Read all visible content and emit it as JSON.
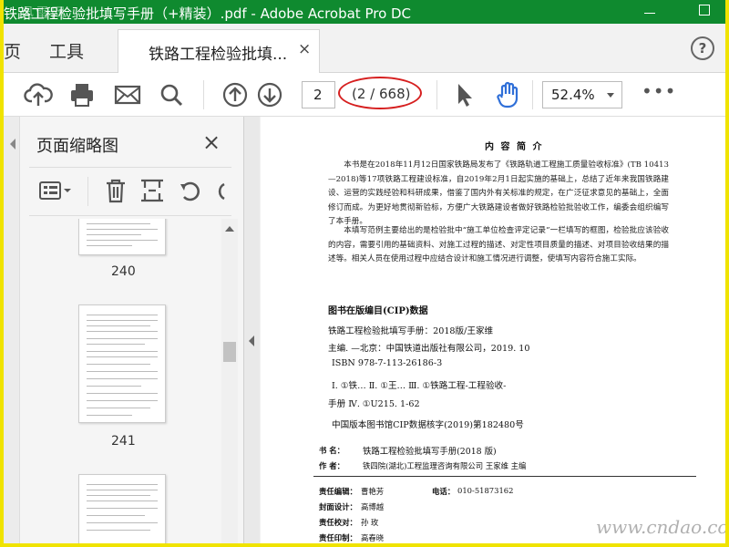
{
  "window": {
    "title": "铁路工程检验批填写手册（+精装）.pdf - Adobe Acrobat Pro DC",
    "watermark_logo": "迅雷网"
  },
  "tabs": {
    "home": "页",
    "tools": "工具",
    "document": "铁路工程检验批填...",
    "close": "×",
    "help": "?"
  },
  "toolbar": {
    "icons": [
      "upload-icon",
      "print-icon",
      "email-icon",
      "search-icon",
      "page-up-icon",
      "page-down-icon",
      "select-cursor-icon",
      "hand-icon"
    ],
    "page_input": "2",
    "page_count": "(2 / 668)",
    "zoom": "52.4%",
    "more": "•••"
  },
  "panel": {
    "title": "页面缩略图",
    "close": "×",
    "tools": [
      "thumbnail-options-icon",
      "delete-icon",
      "crop-icon",
      "rotate-ccw-icon",
      "rotate-cw-icon"
    ],
    "thumbnails": [
      "240",
      "241"
    ]
  },
  "document": {
    "heading": "内 容 简 介",
    "para1": "本书是在2018年11月12日国家铁路局发布了《铁路轨道工程施工质量验收标准》(TB 10413—2018)等17项铁路工程建设标准，自2019年2月1日起实施的基础上，总结了近年来我国铁路建设、运营的实践经验和科研成果，借鉴了国内外有关标准的规定，在广泛征求意见的基础上，全面修订而成。为更好地贯彻新验标，方便广大铁路建设者做好铁路检验批验收工作，编委会组织编写了本手册。",
    "para2": "本填写范例主要给出的是检验批中“施工单位检查评定记录”一栏填写的框图，检验批应该验收的内容，需要引用的基础资料、对施工过程的描述、对定性项目质量的描述、对项目验收结果的描述等。相关人员在使用过程中应结合设计和施工情况进行调整，使填写内容符合施工实际。",
    "cip_heading": "图书在版编目(CIP)数据",
    "cip1": "铁路工程检验批填写手册：2018版/王家维",
    "cip2": "主编. —北京：中国铁道出版社有限公司，2019. 10",
    "cip3": "ISBN 978-7-113-26186-3",
    "cip4": "Ⅰ. ①铁…   Ⅱ. ①王…   Ⅲ. ①铁路工程-工程验收-",
    "cip5": "手册   Ⅳ. ①U215. 1-62",
    "cip6": "中国版本图书馆CIP数据核字(2019)第182480号",
    "book_label": "书    名：",
    "book_value": "铁路工程检验批填写手册(2018 版)",
    "author_label": "作    者：",
    "author_value": "铁四院(湖北)工程监理咨询有限公司  王家维  主编",
    "editor_label": "责任编辑：",
    "editor_value": "曹艳芳",
    "phone_label": "电话：",
    "phone_value": "010-51873162",
    "cover_label": "封面设计：",
    "cover_value": "高博越",
    "proof_label": "责任校对：",
    "proof_value": "孙  玫",
    "print_label": "责任印制：",
    "print_value": "高春晓",
    "site_watermark": "www.cndao.com"
  },
  "colors": {
    "titlebar": "#0f8a2f",
    "frame": "#f0e300",
    "annotation": "#d61f1f",
    "hand_tool": "#2f6fd8"
  }
}
